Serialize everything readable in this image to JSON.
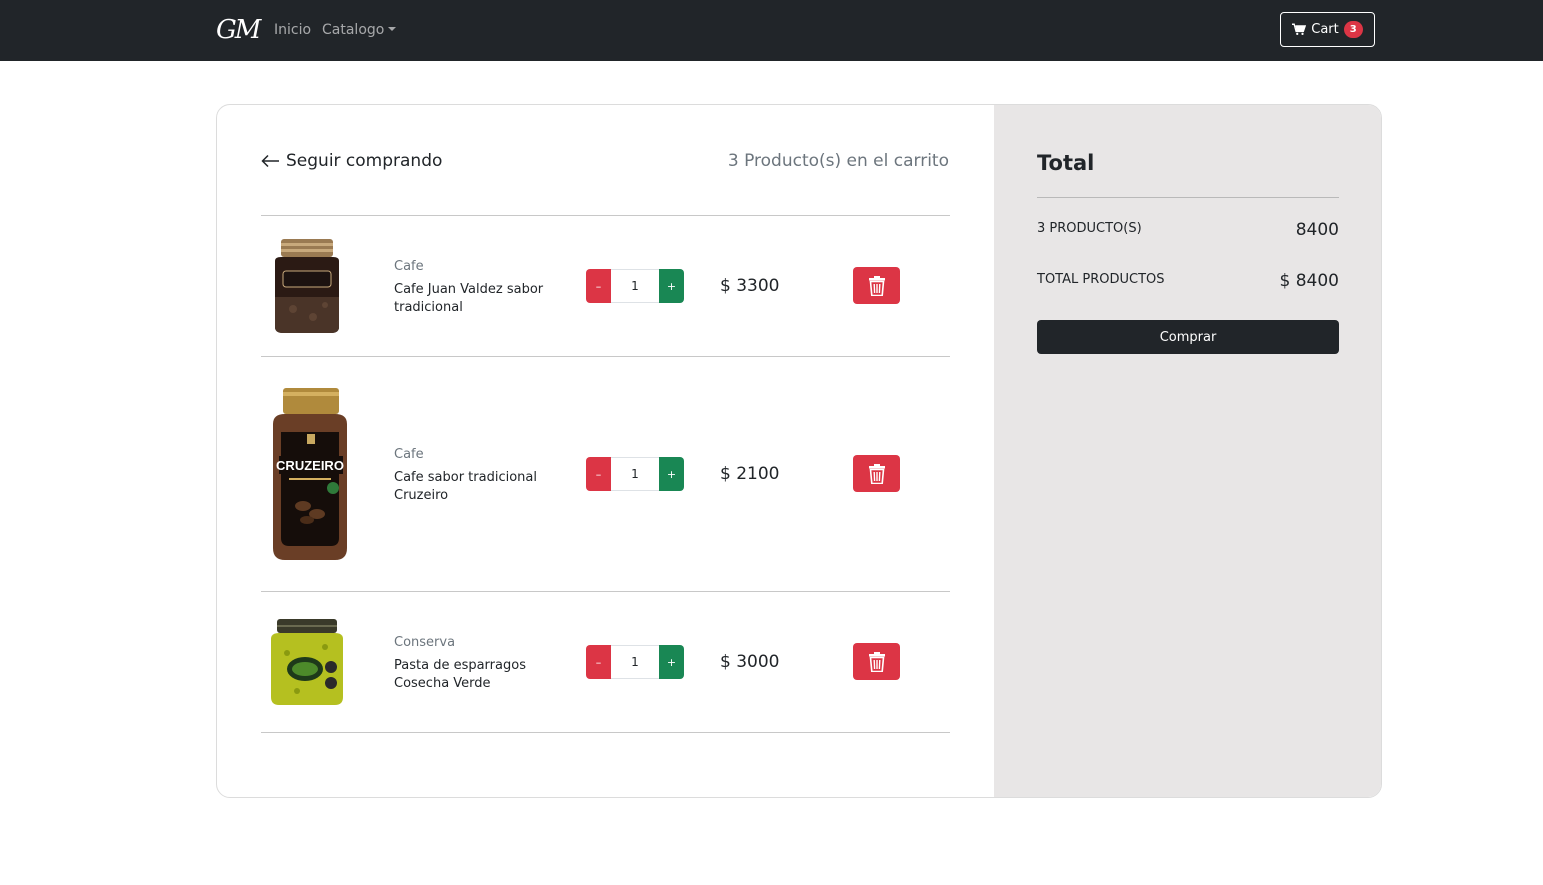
{
  "navbar": {
    "brand": "GM",
    "links": [
      {
        "label": "Inicio"
      },
      {
        "label": "Catalogo"
      }
    ],
    "cart": {
      "label": "Cart",
      "count": "3"
    }
  },
  "cart": {
    "back_label": "Seguir comprando",
    "count_text": "3 Producto(s) en el carrito",
    "items": [
      {
        "category": "Cafe",
        "name": "Cafe Juan Valdez sabor tradicional",
        "quantity": "1",
        "price": "$ 3300",
        "minus": "–",
        "plus": "+"
      },
      {
        "category": "Cafe",
        "name": "Cafe sabor tradicional Cruzeiro",
        "quantity": "1",
        "price": "$ 2100",
        "minus": "–",
        "plus": "+",
        "label_text": "CRUZEIRO"
      },
      {
        "category": "Conserva",
        "name": "Pasta de esparragos Cosecha Verde",
        "quantity": "1",
        "price": "$ 3000",
        "minus": "–",
        "plus": "+"
      }
    ]
  },
  "summary": {
    "title": "Total",
    "products_label": "3 PRODUCTO(S)",
    "products_value": "8400",
    "total_label": "TOTAL PRODUCTOS",
    "total_value": "$ 8400",
    "buy_label": "Comprar"
  },
  "colors": {
    "navbar_bg": "#212529",
    "summary_bg": "#e8e6e6",
    "danger": "#dc3545",
    "success": "#198754"
  }
}
